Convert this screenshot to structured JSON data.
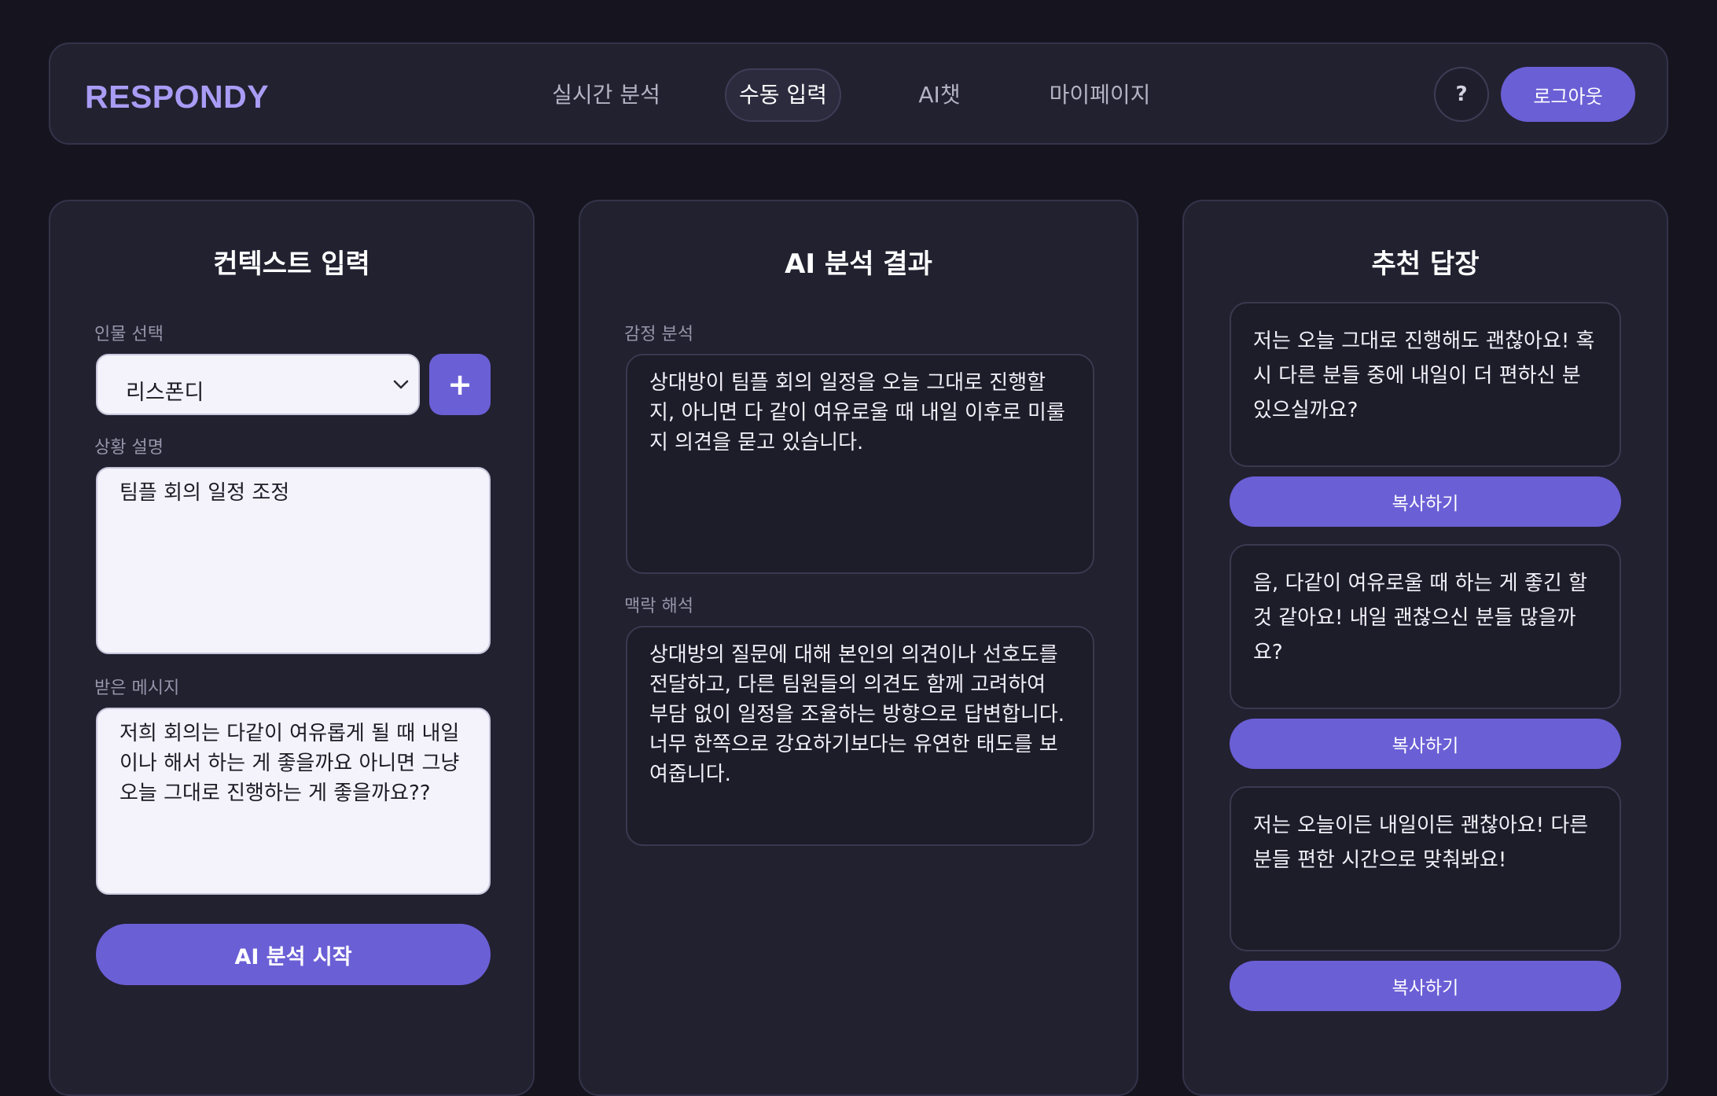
{
  "header": {
    "logo": "RESPONDY",
    "tabs": [
      {
        "label": "실시간 분석",
        "active": false
      },
      {
        "label": "수동 입력",
        "active": true
      },
      {
        "label": "AI챗",
        "active": false
      },
      {
        "label": "마이페이지",
        "active": false
      }
    ],
    "help_label": "?",
    "logout_label": "로그아웃"
  },
  "context_panel": {
    "title": "컨텍스트 입력",
    "person_label": "인물 선택",
    "person_selected": "리스폰디",
    "add_label": "+",
    "situation_label": "상황 설명",
    "situation_value": "팀플 회의 일정 조정",
    "message_label": "받은 메시지",
    "message_value": "저희 회의는 다같이 여유롭게 될 때 내일이나 해서 하는 게 좋을까요 아니면 그냥 오늘 그대로 진행하는 게 좋을까요??",
    "analyze_label": "AI 분석 시작"
  },
  "analysis_panel": {
    "title": "AI 분석 결과",
    "emotion_label": "감정 분석",
    "emotion_text": "상대방이 팀플 회의 일정을 오늘 그대로 진행할지, 아니면 다 같이 여유로울 때 내일 이후로 미룰지 의견을 묻고 있습니다.",
    "context_label": "맥락 해석",
    "context_text": "상대방의 질문에 대해 본인의 의견이나 선호도를 전달하고, 다른 팀원들의 의견도 함께 고려하여 부담 없이 일정을 조율하는 방향으로 답변합니다. 너무 한쪽으로 강요하기보다는 유연한 태도를 보여줍니다."
  },
  "replies_panel": {
    "title": "추천 답장",
    "copy_label": "복사하기",
    "replies": [
      "저는 오늘 그대로 진행해도 괜찮아요! 혹시 다른 분들 중에 내일이 더 편하신 분 있으실까요?",
      "음, 다같이 여유로울 때 하는 게 좋긴 할 것 같아요! 내일 괜찮으신 분들 많을까요?",
      "저는 오늘이든 내일이든 괜찮아요! 다른 분들 편한 시간으로 맞춰봐요!"
    ]
  },
  "colors": {
    "background": "#16151f",
    "panel": "#222130",
    "accent": "#6b5fd6",
    "logo": "#a99cf5"
  },
  "icons": {
    "select_arrow": "chevron-down-icon",
    "add": "plus-icon",
    "help": "question-icon"
  }
}
